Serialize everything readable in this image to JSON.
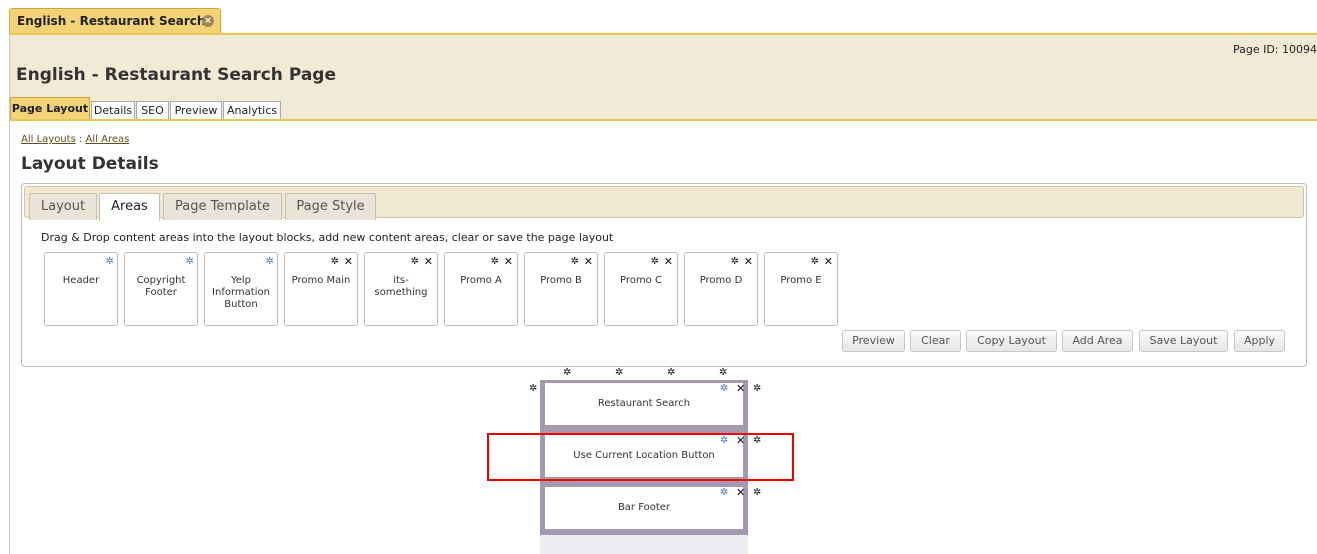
{
  "doc_tab": {
    "label": "English - Restaurant Search Page"
  },
  "page": {
    "id_label": "Page ID: 10094",
    "title": "English - Restaurant Search Page"
  },
  "main_tabs": [
    "Page Layout",
    "Details",
    "SEO",
    "Preview",
    "Analytics"
  ],
  "breadcrumb": {
    "all_layouts": "All Layouts",
    "separator": ":",
    "all_areas": "All Areas"
  },
  "layout_title": "Layout Details",
  "sub_tabs": [
    "Layout",
    "Areas",
    "Page Template",
    "Page Style"
  ],
  "instructions": "Drag & Drop content areas into the layout blocks, add new content areas, clear or save the page layout",
  "area_cards": [
    "Header",
    "Copyright Footer",
    "Yelp Information Button",
    "Promo Main",
    "its-something",
    "Promo A",
    "Promo B",
    "Promo C",
    "Promo D",
    "Promo E"
  ],
  "buttons": [
    "Preview",
    "Clear",
    "Copy Layout",
    "Add Area",
    "Save Layout",
    "Apply"
  ],
  "layout_blocks": [
    "Restaurant Search",
    "Use Current Location Button",
    "Bar Footer"
  ],
  "icons": {
    "gear": "gear-icon",
    "close": "close-icon"
  }
}
